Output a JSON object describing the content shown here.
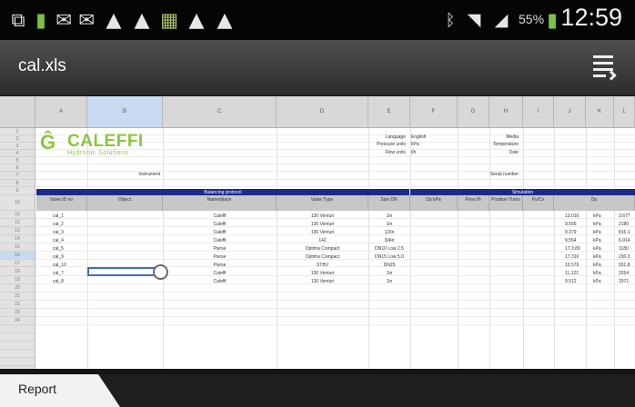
{
  "status_bar": {
    "battery_percent": "55%",
    "clock": "12:59",
    "icons": [
      "screen-cast-icon",
      "battery-charging-icon",
      "mail-icon",
      "mail-multiple-icon",
      "warning-icon",
      "warning-icon",
      "app-icon",
      "warning-icon",
      "warning-icon",
      "bluetooth-icon",
      "wifi-icon",
      "signal-icon",
      "battery-icon"
    ]
  },
  "app_bar": {
    "title": "cal.xls",
    "menu_icon": "overflow-menu-icon"
  },
  "columns": [
    "A",
    "B",
    "C",
    "D",
    "E",
    "F",
    "G",
    "H",
    "I",
    "J",
    "K",
    "L"
  ],
  "rows": [
    "1",
    "2",
    "3",
    "4",
    "5",
    "6",
    "7",
    "8",
    "9",
    "10",
    "11",
    "12",
    "13",
    "14",
    "15",
    "16",
    "17",
    "18",
    "19",
    "20",
    "21",
    "22",
    "23",
    "24"
  ],
  "logo": {
    "mark": "Ĝ",
    "name": "CALEFFI",
    "tagline": "Hydronic Solutions"
  },
  "header_fields": {
    "language_label": "Language",
    "language_value": "English",
    "pressure_label": "Pressure units",
    "pressure_value": "kPa",
    "flow_label": "Flow units",
    "flow_value": "l/h",
    "media_label": "Media",
    "temperature_label": "Temperature",
    "date_label": "Date",
    "instrument_label": "Instrument",
    "serial_label": "Serial number"
  },
  "bands": {
    "balancing": "Balancing protocol",
    "simulation": "Simulation"
  },
  "table_headers": {
    "valve": "Valve ID no",
    "object": "Object",
    "name": "Name/place",
    "valve_type": "Valve Type",
    "size": "Size DN",
    "dp": "Dp kPa",
    "flow": "Flow l/h",
    "position": "Position Turns",
    "kv": "Kv/Cv",
    "dp2": "Dp"
  },
  "table_rows": [
    {
      "id": "cal_1",
      "name": "Caleffi",
      "type": "130 Venturi",
      "size": "1in",
      "j": "13.016",
      "k": "kPa",
      "l": "3.677"
    },
    {
      "id": "cal_2",
      "name": "Caleffi",
      "type": "130 Venturi",
      "size": "1in",
      "j": "9.566",
      "k": "kPa",
      "l": "2180"
    },
    {
      "id": "cal_3",
      "name": "Caleffi",
      "type": "130 Venturi",
      "size": "1/2in",
      "j": "9.379",
      "k": "kPa",
      "l": "816.1"
    },
    {
      "id": "cal_4",
      "name": "Caleffi",
      "type": "142",
      "size": "3/4in",
      "j": "9.554",
      "k": "kPa",
      "l": "6.014"
    },
    {
      "id": "cal_5",
      "name": "Pwrse",
      "type": "Optima Compact",
      "size": "DN10 Low 2.5",
      "j": "17.3.89",
      "k": "kPa",
      "l": "1180"
    },
    {
      "id": "cal_9",
      "name": "Pwrse",
      "type": "Optima Compact",
      "size": "DN15 Low 5.0",
      "j": "17.316",
      "k": "kPa",
      "l": "230.0"
    },
    {
      "id": "cal_10",
      "name": "Pwrse",
      "type": "STBV",
      "size": "DN25",
      "j": "10.576",
      "k": "kPa",
      "l": "931.8"
    },
    {
      "id": "cal_7",
      "name": "Caleffi",
      "type": "130 Venturi",
      "size": "1in",
      "j": "11.122",
      "k": "kPa",
      "l": "3254"
    },
    {
      "id": "cal_8",
      "name": "Caleffi",
      "type": "130 Venturi",
      "size": "1in",
      "j": "9.512",
      "k": "kPa",
      "l": "2971"
    }
  ],
  "tabs": [
    {
      "label": "Report"
    }
  ]
}
